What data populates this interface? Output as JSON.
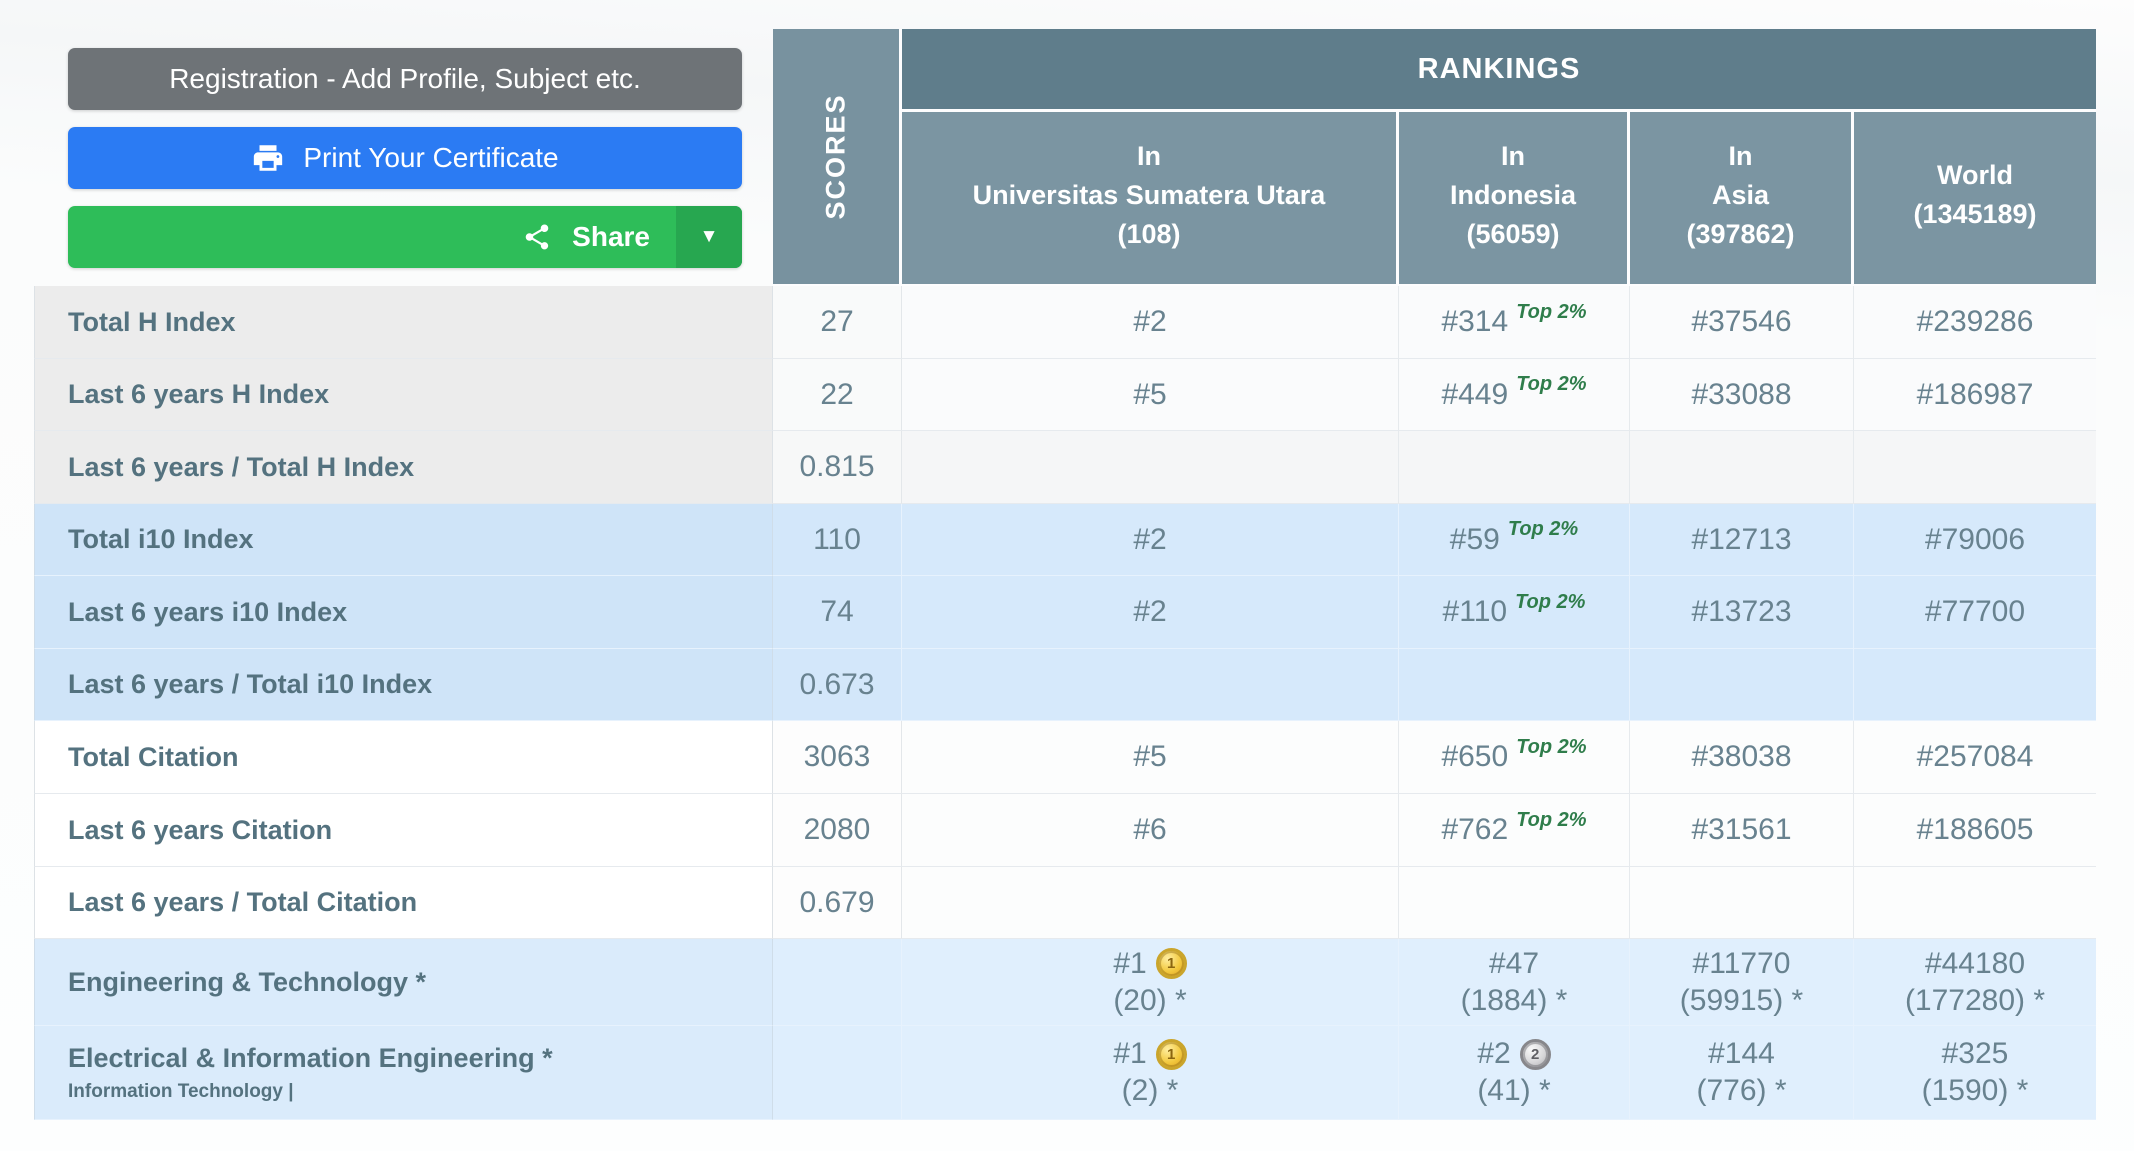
{
  "buttons": {
    "registration": "Registration - Add Profile, Subject etc.",
    "print": "Print Your Certificate",
    "share": "Share",
    "caret_glyph": "▼"
  },
  "colors": {
    "button_gray": "#6e7377",
    "button_blue": "#2b7bf3",
    "button_green": "#2ebd59",
    "button_green_dark": "#27a750",
    "header_dark_slate": "#5f7d8b",
    "header_mid_slate": "#7b95a2",
    "row_blue": "#cfe4f8",
    "row_blue_light": "#daebfb",
    "row_gray": "#ececec",
    "top2_green": "#2f7d4b",
    "medal_gold": "#f2c83d",
    "medal_silver": "#d6d6d8",
    "text_label": "#54727f",
    "text_value": "#68828f"
  },
  "table": {
    "scores_header": "SCORES",
    "rankings_header": "RANKINGS",
    "columns": [
      {
        "line1": "In",
        "line2": "Universitas Sumatera Utara",
        "line3": "(108)"
      },
      {
        "line1": "In",
        "line2": "Indonesia",
        "line3": "(56059)"
      },
      {
        "line1": "In",
        "line2": "Asia",
        "line3": "(397862)"
      },
      {
        "line1": "World",
        "line2": "(1345189)",
        "line3": ""
      }
    ],
    "rows": [
      {
        "label": "Total H Index",
        "sublabel": "",
        "score": "27",
        "cells": [
          {
            "rank": "#2",
            "badge": "",
            "medal": "",
            "sub": ""
          },
          {
            "rank": "#314",
            "badge": "Top 2%",
            "medal": "",
            "sub": ""
          },
          {
            "rank": "#37546",
            "badge": "",
            "medal": "",
            "sub": ""
          },
          {
            "rank": "#239286",
            "badge": "",
            "medal": "",
            "sub": ""
          }
        ]
      },
      {
        "label": "Last 6 years H Index",
        "sublabel": "",
        "score": "22",
        "cells": [
          {
            "rank": "#5",
            "badge": "",
            "medal": "",
            "sub": ""
          },
          {
            "rank": "#449",
            "badge": "Top 2%",
            "medal": "",
            "sub": ""
          },
          {
            "rank": "#33088",
            "badge": "",
            "medal": "",
            "sub": ""
          },
          {
            "rank": "#186987",
            "badge": "",
            "medal": "",
            "sub": ""
          }
        ]
      },
      {
        "label": "Last 6 years / Total H Index",
        "sublabel": "",
        "score": "0.815",
        "cells": [
          {
            "rank": "",
            "badge": "",
            "medal": "",
            "sub": ""
          },
          {
            "rank": "",
            "badge": "",
            "medal": "",
            "sub": ""
          },
          {
            "rank": "",
            "badge": "",
            "medal": "",
            "sub": ""
          },
          {
            "rank": "",
            "badge": "",
            "medal": "",
            "sub": ""
          }
        ]
      },
      {
        "label": "Total i10 Index",
        "sublabel": "",
        "score": "110",
        "cells": [
          {
            "rank": "#2",
            "badge": "",
            "medal": "",
            "sub": ""
          },
          {
            "rank": "#59",
            "badge": "Top 2%",
            "medal": "",
            "sub": ""
          },
          {
            "rank": "#12713",
            "badge": "",
            "medal": "",
            "sub": ""
          },
          {
            "rank": "#79006",
            "badge": "",
            "medal": "",
            "sub": ""
          }
        ]
      },
      {
        "label": "Last 6 years i10 Index",
        "sublabel": "",
        "score": "74",
        "cells": [
          {
            "rank": "#2",
            "badge": "",
            "medal": "",
            "sub": ""
          },
          {
            "rank": "#110",
            "badge": "Top 2%",
            "medal": "",
            "sub": ""
          },
          {
            "rank": "#13723",
            "badge": "",
            "medal": "",
            "sub": ""
          },
          {
            "rank": "#77700",
            "badge": "",
            "medal": "",
            "sub": ""
          }
        ]
      },
      {
        "label": "Last 6 years / Total i10 Index",
        "sublabel": "",
        "score": "0.673",
        "cells": [
          {
            "rank": "",
            "badge": "",
            "medal": "",
            "sub": ""
          },
          {
            "rank": "",
            "badge": "",
            "medal": "",
            "sub": ""
          },
          {
            "rank": "",
            "badge": "",
            "medal": "",
            "sub": ""
          },
          {
            "rank": "",
            "badge": "",
            "medal": "",
            "sub": ""
          }
        ]
      },
      {
        "label": "Total Citation",
        "sublabel": "",
        "score": "3063",
        "cells": [
          {
            "rank": "#5",
            "badge": "",
            "medal": "",
            "sub": ""
          },
          {
            "rank": "#650",
            "badge": "Top 2%",
            "medal": "",
            "sub": ""
          },
          {
            "rank": "#38038",
            "badge": "",
            "medal": "",
            "sub": ""
          },
          {
            "rank": "#257084",
            "badge": "",
            "medal": "",
            "sub": ""
          }
        ]
      },
      {
        "label": "Last 6 years Citation",
        "sublabel": "",
        "score": "2080",
        "cells": [
          {
            "rank": "#6",
            "badge": "",
            "medal": "",
            "sub": ""
          },
          {
            "rank": "#762",
            "badge": "Top 2%",
            "medal": "",
            "sub": ""
          },
          {
            "rank": "#31561",
            "badge": "",
            "medal": "",
            "sub": ""
          },
          {
            "rank": "#188605",
            "badge": "",
            "medal": "",
            "sub": ""
          }
        ]
      },
      {
        "label": "Last 6 years / Total Citation",
        "sublabel": "",
        "score": "0.679",
        "cells": [
          {
            "rank": "",
            "badge": "",
            "medal": "",
            "sub": ""
          },
          {
            "rank": "",
            "badge": "",
            "medal": "",
            "sub": ""
          },
          {
            "rank": "",
            "badge": "",
            "medal": "",
            "sub": ""
          },
          {
            "rank": "",
            "badge": "",
            "medal": "",
            "sub": ""
          }
        ]
      },
      {
        "label": "Engineering & Technology *",
        "sublabel": "",
        "score": "",
        "cells": [
          {
            "rank": "#1",
            "badge": "",
            "medal": "1",
            "sub": "(20) *"
          },
          {
            "rank": "#47",
            "badge": "",
            "medal": "",
            "sub": "(1884) *"
          },
          {
            "rank": "#11770",
            "badge": "",
            "medal": "",
            "sub": "(59915) *"
          },
          {
            "rank": "#44180",
            "badge": "",
            "medal": "",
            "sub": "(177280) *"
          }
        ]
      },
      {
        "label": "Electrical & Information Engineering *",
        "sublabel": "Information Technology |",
        "score": "",
        "cells": [
          {
            "rank": "#1",
            "badge": "",
            "medal": "1",
            "sub": "(2) *"
          },
          {
            "rank": "#2",
            "badge": "",
            "medal": "2",
            "sub": "(41) *"
          },
          {
            "rank": "#144",
            "badge": "",
            "medal": "",
            "sub": "(776) *"
          },
          {
            "rank": "#325",
            "badge": "",
            "medal": "",
            "sub": "(1590) *"
          }
        ]
      }
    ]
  }
}
